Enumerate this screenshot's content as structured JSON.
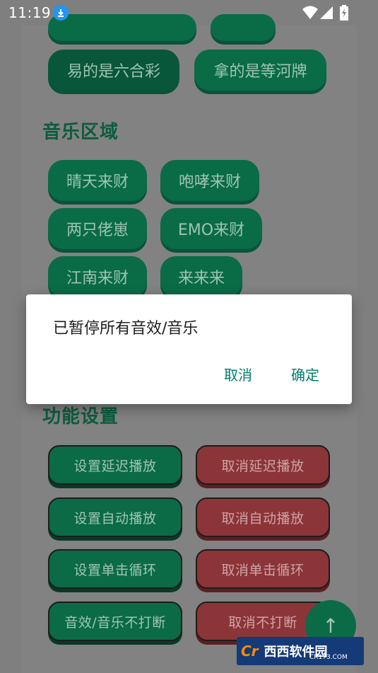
{
  "status_bar": {
    "time": "11:19",
    "icons": [
      "download-icon",
      "wifi-icon",
      "signal-icon",
      "battery-icon"
    ]
  },
  "top_buttons": {
    "row1": [
      "易的是六合彩",
      "拿的是等河牌"
    ]
  },
  "music": {
    "title": "音乐区域",
    "buttons": [
      "晴天来财",
      "咆哮来财",
      "两只佬崽",
      "EMO来财",
      "江南来财",
      "来来来"
    ]
  },
  "functions": {
    "title": "功能设置",
    "buttons": [
      {
        "label": "设置延迟播放",
        "color": "green"
      },
      {
        "label": "取消延迟播放",
        "color": "red"
      },
      {
        "label": "设置自动播放",
        "color": "green"
      },
      {
        "label": "取消自动播放",
        "color": "red"
      },
      {
        "label": "设置单击循环",
        "color": "green"
      },
      {
        "label": "取消单击循环",
        "color": "red"
      },
      {
        "label": "音效/音乐不打断",
        "color": "green"
      },
      {
        "label": "取消不打断",
        "color": "red"
      }
    ]
  },
  "fab": {
    "icon": "arrow-up-icon",
    "glyph": "↑"
  },
  "dialog": {
    "message": "已暂停所有音效/音乐",
    "cancel_label": "取消",
    "confirm_label": "确定"
  },
  "watermark": {
    "brand": "Cr",
    "text": "西西软件园",
    "sub": "CR173.COM"
  },
  "colors": {
    "accent": "#007d6a",
    "green_button": "#0b6b46",
    "red_button": "#8b3538"
  }
}
